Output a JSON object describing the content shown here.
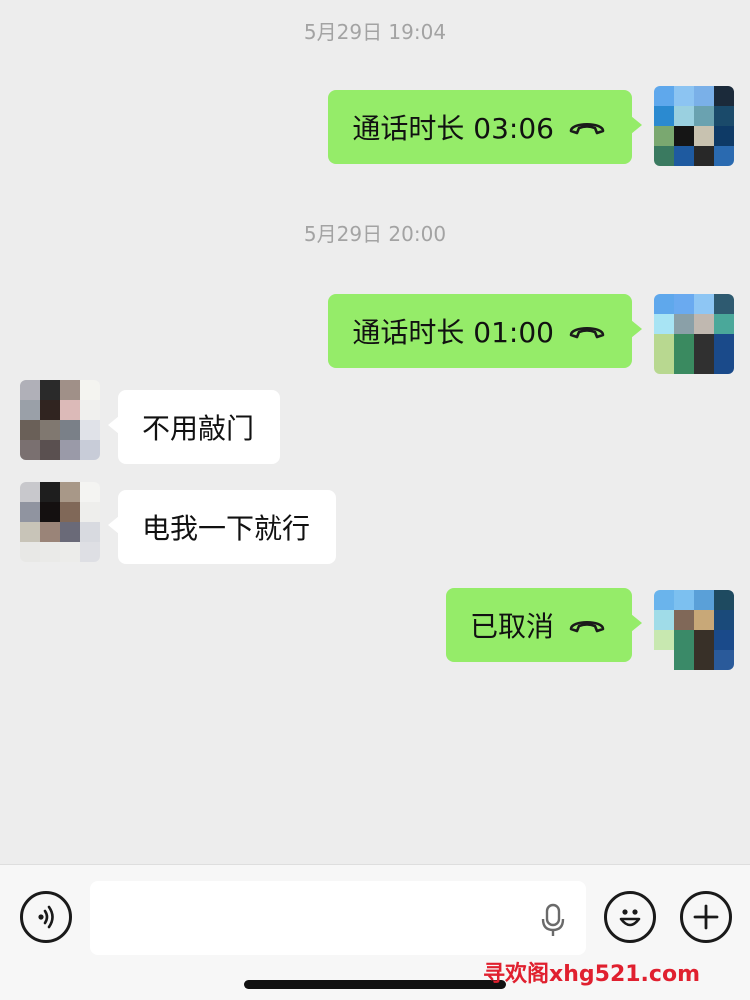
{
  "messages": {
    "ts1": "5月29日 19:04",
    "m1": {
      "text": "通话时长 03:06",
      "icon": "phone-hangup-icon"
    },
    "ts2": "5月29日 20:00",
    "m2": {
      "text": "通话时长 01:00",
      "icon": "phone-hangup-icon"
    },
    "m3": {
      "text": "不用敲门"
    },
    "m4": {
      "text": "电我一下就行"
    },
    "m5": {
      "text": "已取消",
      "icon": "phone-hangup-icon"
    }
  },
  "composer": {
    "voice_icon": "voice-icon",
    "mic_icon": "microphone-icon",
    "emoji_icon": "emoji-icon",
    "plus_icon": "plus-icon"
  },
  "watermark": "寻欢阁xhg521.com",
  "colors": {
    "sent_bubble": "#95ec69",
    "recv_bubble": "#ffffff",
    "background": "#ededed",
    "timestamp": "#a3a3a3"
  }
}
